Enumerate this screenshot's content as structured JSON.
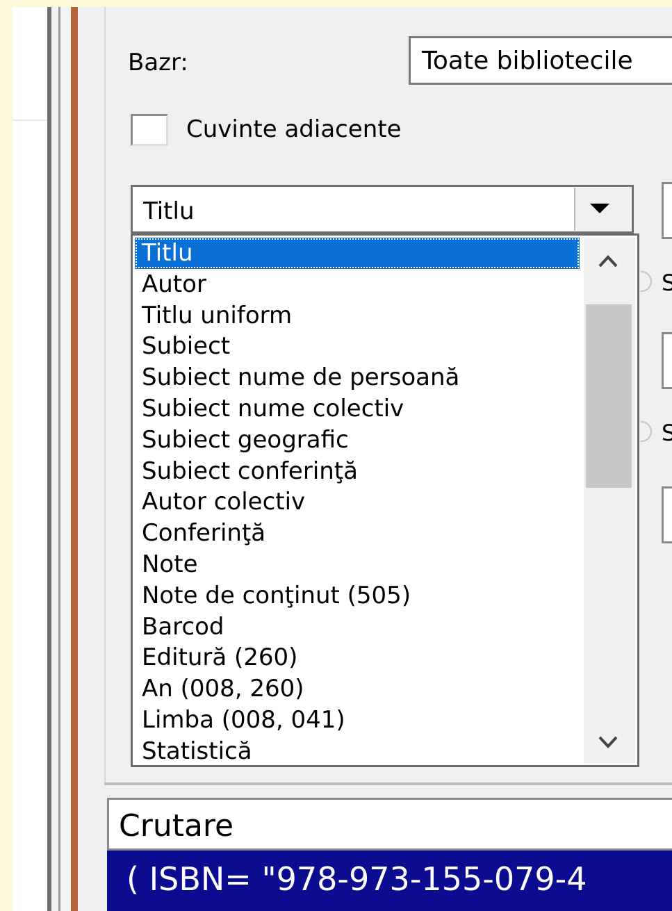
{
  "base": {
    "label": "Bazr:",
    "value": "Toate bibliotecile"
  },
  "adjacent_words": {
    "label": "Cuvinte adiacente",
    "checked": false
  },
  "field_combo": {
    "value": "Titlu"
  },
  "field_options": [
    "Titlu",
    "Autor",
    "Titlu uniform",
    "Subiect",
    "Subiect nume de persoană",
    "Subiect nume colectiv",
    "Subiect geografic",
    "Subiect conferinţă",
    "Autor colectiv",
    "Conferinţă",
    "Note",
    "Note de conţinut (505)",
    "Barcod",
    "Editură (260)",
    "An (008, 260)",
    "Limba (008, 041)",
    "Statistică"
  ],
  "right_panel": {
    "radio1_text": "S",
    "radio2_text": "S"
  },
  "search": {
    "header": "Crutare",
    "query": "( ISBN= \"978-973-155-079-4"
  },
  "colors": {
    "selection": "#0a6fd6",
    "query_bg": "#0b0c8f",
    "frame_accent": "#b4623a"
  }
}
